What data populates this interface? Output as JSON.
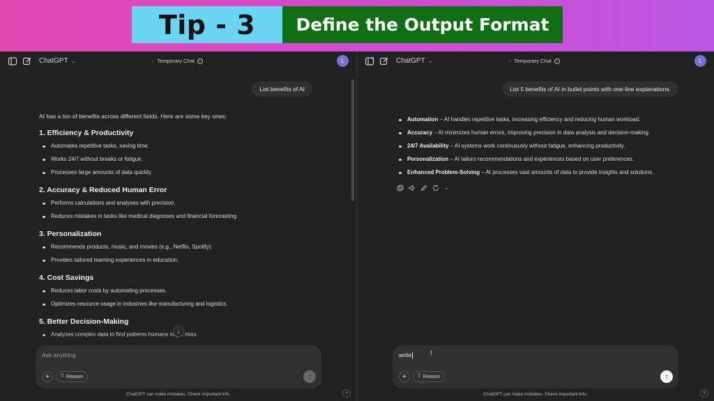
{
  "banner": {
    "tip": "Tip - 3",
    "title": "Define the Output Format"
  },
  "left": {
    "model": "ChatGPT",
    "temporary": "Temporary Chat",
    "avatar": "L",
    "user_message": "List benefits of AI",
    "intro": "AI has a ton of benefits across different fields. Here are some key ones:",
    "sections": [
      {
        "title": "1. Efficiency & Productivity",
        "points": [
          "Automates repetitive tasks, saving time.",
          "Works 24/7 without breaks or fatigue.",
          "Processes large amounts of data quickly."
        ]
      },
      {
        "title": "2. Accuracy & Reduced Human Error",
        "points": [
          "Performs calculations and analyses with precision.",
          "Reduces mistakes in tasks like medical diagnoses and financial forecasting."
        ]
      },
      {
        "title": "3. Personalization",
        "points": [
          "Recommends products, music, and movies (e.g., Netflix, Spotify).",
          "Provides tailored learning experiences in education."
        ]
      },
      {
        "title": "4. Cost Savings",
        "points": [
          "Reduces labor costs by automating processes.",
          "Optimizes resource usage in industries like manufacturing and logistics."
        ]
      },
      {
        "title": "5. Better Decision-Making",
        "points": [
          "Analyzes complex data to find patterns humans might miss."
        ]
      }
    ],
    "composer_placeholder": "Ask anything",
    "reason_label": "Reason",
    "disclaimer": "ChatGPT can make mistakes. Check important info.",
    "help": "?"
  },
  "right": {
    "model": "ChatGPT",
    "temporary": "Temporary Chat",
    "avatar": "L",
    "user_message": "List 5 benefits of AI in bullet points with one-line explanations.",
    "items": [
      {
        "term": "Automation",
        "text": " – AI handles repetitive tasks, increasing efficiency and reducing human workload."
      },
      {
        "term": "Accuracy",
        "text": " – AI minimizes human errors, improving precision in data analysis and decision-making."
      },
      {
        "term": "24/7 Availability",
        "text": " – AI systems work continuously without fatigue, enhancing productivity."
      },
      {
        "term": "Personalization",
        "text": " – AI tailors recommendations and experiences based on user preferences."
      },
      {
        "term": "Enhanced Problem-Solving",
        "text": " – AI processes vast amounts of data to provide insights and solutions."
      }
    ],
    "composer_value": "write",
    "reason_label": "Reason",
    "disclaimer": "ChatGPT can make mistakes. Check important info.",
    "help": "?"
  },
  "colors": {
    "banner_tip_bg": "#6ad4f3",
    "banner_title_bg": "#0f6f12",
    "pane_bg": "#212121",
    "bubble_bg": "#303030",
    "avatar_bg": "#7a6fd6"
  }
}
